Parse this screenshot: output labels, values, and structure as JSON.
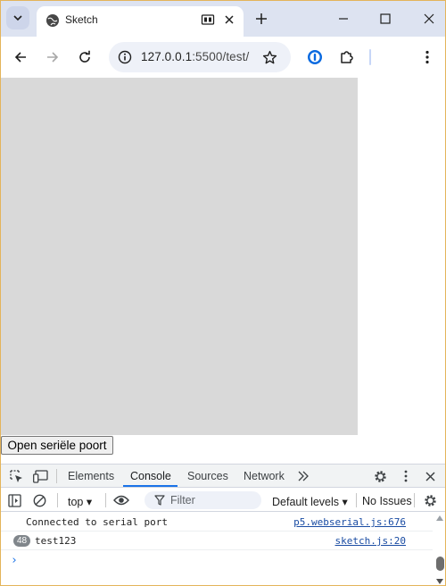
{
  "browser": {
    "tab_title": "Sketch",
    "url_host": "127.0.0.1",
    "url_path": ":5500/test/"
  },
  "page": {
    "button_label": "Open seriële poort"
  },
  "devtools": {
    "tabs": [
      "Elements",
      "Console",
      "Sources",
      "Network"
    ],
    "active_tab": "Console",
    "context": "top ▾",
    "filter_placeholder": "Filter",
    "levels": "Default levels ▾",
    "issues": "No Issues",
    "logs": [
      {
        "message": "Connected to serial port",
        "source": "p5.webserial.js:676"
      },
      {
        "count": "48",
        "message": "test123",
        "source": "sketch.js:20"
      }
    ],
    "prompt": "›"
  },
  "colors": {
    "accent": "#1a73e8",
    "tabstrip": "#dde3f1",
    "canvas": "#d9d9d9",
    "link": "#1a4ca3"
  },
  "icons": [
    "tab-search-icon",
    "globe-icon",
    "media-icon",
    "close-icon",
    "new-tab-icon",
    "minimize-icon",
    "maximize-icon",
    "window-close-icon",
    "back-icon",
    "forward-icon",
    "reload-icon",
    "site-info-icon",
    "bookmark-star-icon",
    "password-manager-icon",
    "extensions-icon",
    "kebab-menu-icon",
    "inspect-icon",
    "device-toggle-icon",
    "more-tabs-icon",
    "settings-icon",
    "sidebar-icon",
    "clear-icon",
    "eye-icon",
    "filter-icon"
  ]
}
